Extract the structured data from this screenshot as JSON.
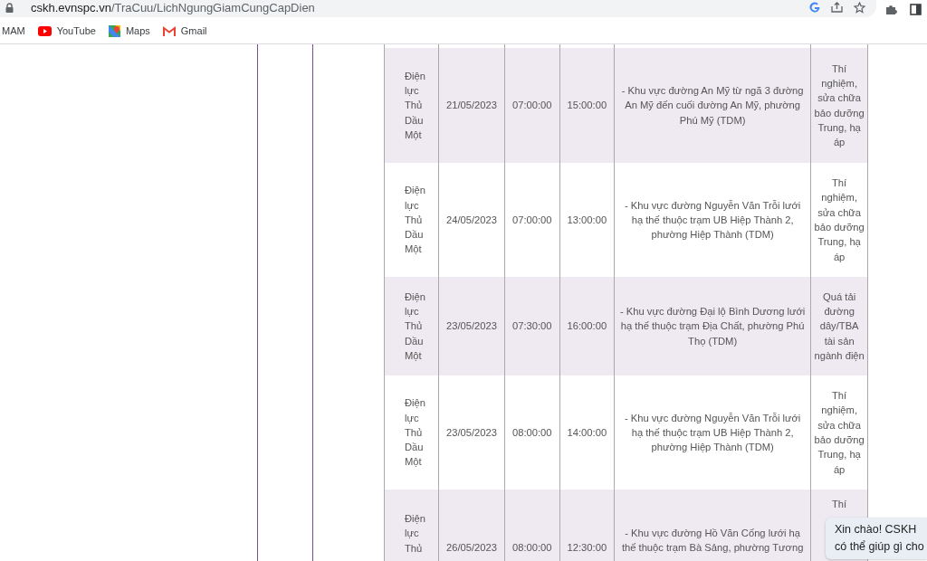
{
  "address_bar": {
    "domain": "cskh.evnspc.vn",
    "path": "/TraCuu/LichNgungGiamCungCapDien"
  },
  "bookmarks": [
    {
      "label": "MAM",
      "kind": "plain"
    },
    {
      "label": "YouTube",
      "kind": "youtube"
    },
    {
      "label": "Maps",
      "kind": "maps"
    },
    {
      "label": "Gmail",
      "kind": "gmail"
    }
  ],
  "table": {
    "rows": [
      {
        "cells": [
          "Điện lực Thủ Dầu Một",
          "21/05/2023",
          "07:00:00",
          "15:00:00",
          "- Khu vực đường An Mỹ từ ngã 3 đường An Mỹ đến cuối đường An Mỹ, phường Phú Mỹ (TDM)",
          "Thí nghiệm, sửa chữa bảo dưỡng Trung, hạ áp"
        ]
      },
      {
        "cells": [
          "Điện lực Thủ Dầu Một",
          "24/05/2023",
          "07:00:00",
          "13:00:00",
          "- Khu vực đường Nguyễn Văn Trỗi lưới hạ thế thuộc trạm UB Hiệp Thành 2, phường Hiệp Thành (TDM)",
          "Thí nghiệm, sửa chữa bảo dưỡng Trung, hạ áp"
        ]
      },
      {
        "cells": [
          "Điện lực Thủ Dầu Một",
          "23/05/2023",
          "07:30:00",
          "16:00:00",
          "- Khu vực đường Đại lộ Bình Dương lưới hạ thế thuộc trạm Địa Chất, phường Phú Thọ (TDM)",
          "Quá tải đường dây/TBA tài sản ngành điện"
        ]
      },
      {
        "cells": [
          "Điện lực Thủ Dầu Một",
          "23/05/2023",
          "08:00:00",
          "14:00:00",
          "- Khu vực đường Nguyễn Văn Trỗi lưới hạ thế thuộc trạm UB Hiệp Thành 2, phường Hiệp Thành (TDM)",
          "Thí nghiệm, sửa chữa bảo dưỡng Trung, hạ áp"
        ]
      },
      {
        "cells": [
          "Điện lực Thủ",
          "26/05/2023",
          "08:00:00",
          "12:30:00",
          "- Khu vực đường Hồ Văn Cống lưới hạ thế thuộc trạm Bà Sảng, phường Tương",
          "Thí"
        ]
      }
    ]
  },
  "chat_bubble": {
    "lines": [
      "Xin chào! CSKH",
      "có thể giúp gì cho"
    ]
  }
}
